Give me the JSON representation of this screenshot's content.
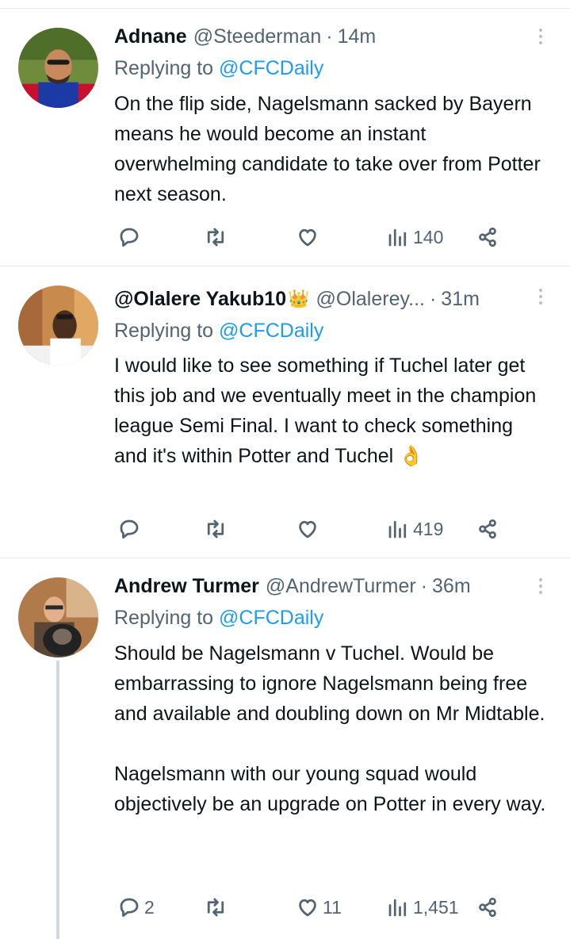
{
  "tweets": [
    {
      "name": "Adnane",
      "handle": "@Steederman",
      "time": "14m",
      "replying_prefix": "Replying to ",
      "replying_to": "@CFCDaily",
      "text": "On the flip side, Nagelsmann sacked by Bayern means he would become an instant overwhelming candidate to take over from Potter next season.",
      "replies": "",
      "retweets": "",
      "likes": "",
      "views": "140"
    },
    {
      "name": "@Olalere Yakub10",
      "name_emoji": "👑",
      "handle": "@Olalerey...",
      "time": "31m",
      "replying_prefix": "Replying to ",
      "replying_to": "@CFCDaily",
      "text": "I would like to see something if Tuchel later get this job and we eventually meet in the champion league Semi Final. I want to check something and it's within Potter and Tuchel 👌",
      "replies": "",
      "retweets": "",
      "likes": "",
      "views": "419"
    },
    {
      "name": "Andrew Turmer",
      "handle": "@AndrewTurmer",
      "time": "36m",
      "replying_prefix": "Replying to ",
      "replying_to": "@CFCDaily",
      "text_p1": "Should be Nagelsmann v Tuchel. Would be embarrassing to ignore Nagelsmann being free and available and doubling down on Mr Midtable.",
      "text_p2": "Nagelsmann with our young squad would objectively be an upgrade on Potter in every way.",
      "replies": "2",
      "retweets": "",
      "likes": "11",
      "views": "1,451"
    }
  ],
  "separator": "·",
  "icons": {
    "reply": "reply-icon",
    "retweet": "retweet-icon",
    "like": "heart-icon",
    "views": "views-icon",
    "share": "share-icon",
    "more": "more-icon"
  },
  "colors": {
    "link": "#1d9bf0",
    "secondary_text": "#536471",
    "divider": "#e7e9ea"
  }
}
